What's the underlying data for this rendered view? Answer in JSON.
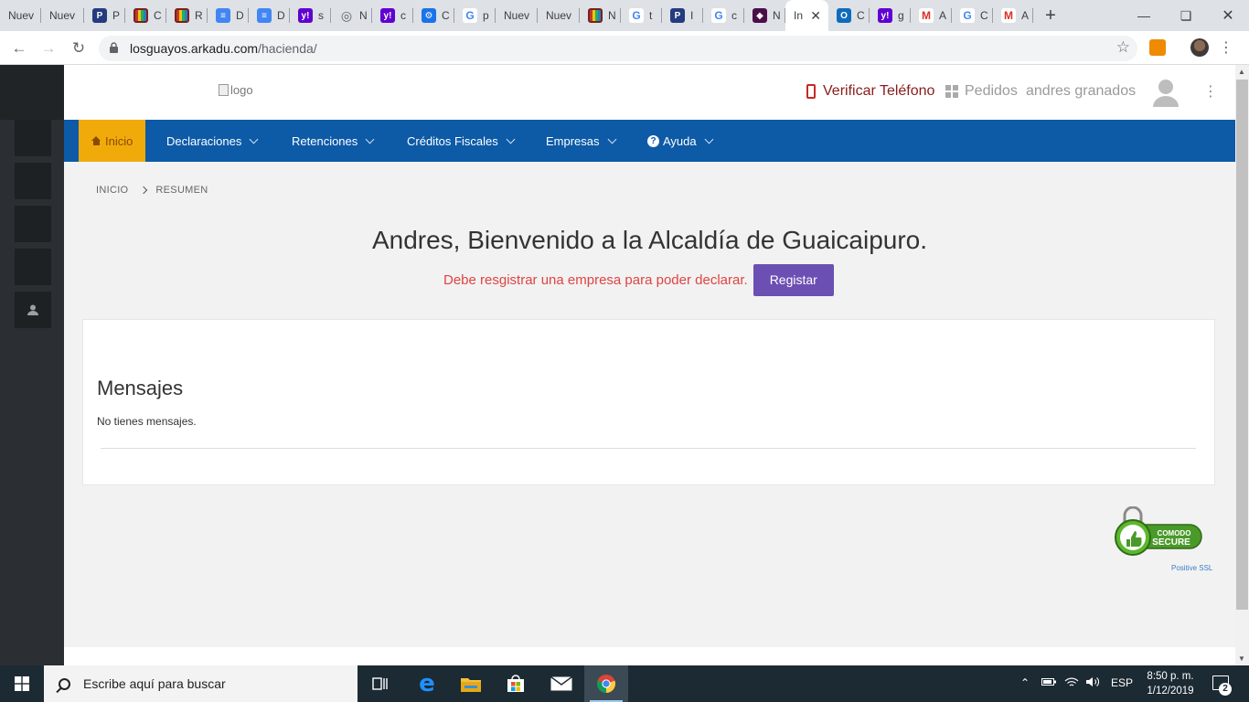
{
  "browser": {
    "tabs": [
      {
        "label": "Nuev",
        "icon": "none",
        "color": ""
      },
      {
        "label": "Nuev",
        "icon": "none",
        "color": ""
      },
      {
        "label": "P",
        "icon": "paypal-icon",
        "color": "#253b80"
      },
      {
        "label": "C",
        "icon": "colors-icon",
        "color": "#7a1f1f"
      },
      {
        "label": "R",
        "icon": "colors-icon",
        "color": "#7a1f1f"
      },
      {
        "label": "D",
        "icon": "docs-icon",
        "color": "#4285f4"
      },
      {
        "label": "D",
        "icon": "docs-icon",
        "color": "#4285f4"
      },
      {
        "label": "s",
        "icon": "yahoo-icon",
        "color": "#6001d2"
      },
      {
        "label": "N",
        "icon": "globe-icon",
        "color": "#5f6368"
      },
      {
        "label": "c",
        "icon": "yahoo-icon",
        "color": "#6001d2"
      },
      {
        "label": "C",
        "icon": "gear-icon",
        "color": "#1a73e8"
      },
      {
        "label": "p",
        "icon": "google-icon",
        "color": "#4285f4"
      },
      {
        "label": "Nuev",
        "icon": "none",
        "color": ""
      },
      {
        "label": "Nuev",
        "icon": "none",
        "color": ""
      },
      {
        "label": "N",
        "icon": "colors-icon",
        "color": "#7a1f1f"
      },
      {
        "label": "t",
        "icon": "google-icon",
        "color": "#4285f4"
      },
      {
        "label": "I",
        "icon": "paypal-icon",
        "color": "#253b80"
      },
      {
        "label": "c",
        "icon": "google-icon",
        "color": "#4285f4"
      },
      {
        "label": "N",
        "icon": "diamond-icon",
        "color": "#4a0f4a"
      },
      {
        "label": "In",
        "icon": "none",
        "color": "",
        "active": true
      },
      {
        "label": "C",
        "icon": "outlook-icon",
        "color": "#0f6cbd"
      },
      {
        "label": "g",
        "icon": "yahoo-icon",
        "color": "#6001d2"
      },
      {
        "label": "A",
        "icon": "gmail-icon",
        "color": "#d93025"
      },
      {
        "label": "C",
        "icon": "google-icon",
        "color": "#4285f4"
      },
      {
        "label": "A",
        "icon": "gmail-icon",
        "color": "#d93025"
      }
    ],
    "new_tab": "+",
    "url_host": "losguayos.arkadu.com",
    "url_path": "/hacienda/"
  },
  "header": {
    "logo_alt": "logo",
    "verify_phone": "Verificar Teléfono",
    "orders": "Pedidos",
    "user_name": "andres granados"
  },
  "nav": {
    "home": "Inicio",
    "items": [
      "Declaraciones",
      "Retenciones",
      "Créditos Fiscales",
      "Empresas",
      "Ayuda"
    ]
  },
  "breadcrumb": {
    "root": "INICIO",
    "current": "RESUMEN"
  },
  "main": {
    "welcome": "Andres, Bienvenido a la Alcaldía de Guaicaipuro.",
    "register_msg": "Debe resgistrar una empresa para poder declarar.",
    "register_btn": "Registar",
    "messages_title": "Mensajes",
    "messages_body": "No tienes mensajes."
  },
  "ssl": {
    "badge_top": "COMODO",
    "badge_bottom": "SECURE",
    "caption": "Positive SSL"
  },
  "taskbar": {
    "search_placeholder": "Escribe aquí para buscar",
    "lang": "ESP",
    "time": "8:50 p. m.",
    "date": "1/12/2019",
    "notifications": "2"
  },
  "colors": {
    "nav_bg": "#0d5aa7",
    "nav_active": "#f0ab0a",
    "register_btn": "#6c4fb3",
    "alert_text": "#e04343",
    "sidebar": "#2b2f33"
  }
}
